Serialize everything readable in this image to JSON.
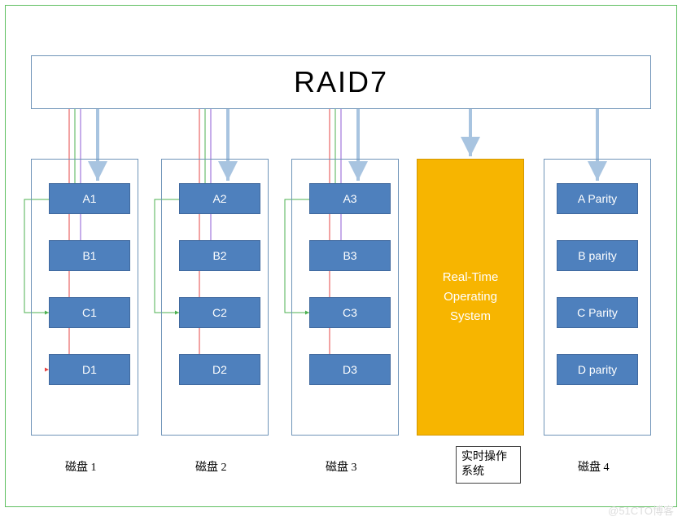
{
  "title": "RAID7",
  "disks": [
    {
      "label": "磁盘 1",
      "blocks": [
        "A1",
        "B1",
        "C1",
        "D1"
      ]
    },
    {
      "label": "磁盘 2",
      "blocks": [
        "A2",
        "B2",
        "C2",
        "D2"
      ]
    },
    {
      "label": "磁盘 3",
      "blocks": [
        "A3",
        "B3",
        "C3",
        "D3"
      ]
    }
  ],
  "rtos": {
    "line1": "Real-Time",
    "line2": "Operating",
    "line3": "System",
    "caption": "实时操作系统"
  },
  "parityDisk": {
    "label": "磁盘 4",
    "blocks": [
      "A Parity",
      "B parity",
      "C Parity",
      "D parity"
    ]
  },
  "watermark": "@51CTO博客",
  "blockYs": [
    225,
    295,
    365,
    435
  ],
  "colors": {
    "arrowBlue": "#a8c4e0",
    "lineRed": "#e64545",
    "lineGreen": "#4cb050",
    "linePurple": "#8e5bd4"
  }
}
